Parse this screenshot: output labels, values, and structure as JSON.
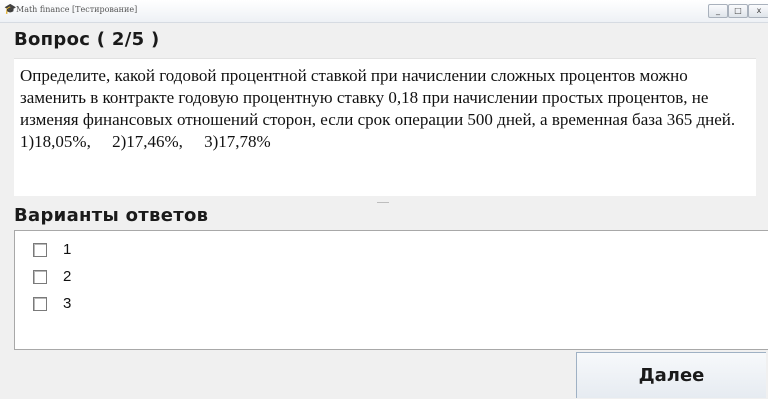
{
  "window": {
    "title": "Math finance [Тестирование]",
    "controls": {
      "minimize": "_",
      "maximize": "□",
      "close": "x"
    }
  },
  "question": {
    "header": "Вопрос ( 2/5 )",
    "text": "Определите, какой годовой процентной ставкой при начислении сложных процентов можно заменить в контракте годовую процентную ставку 0,18 при начислении простых процентов, не изменяя финансовых отношений сторон, если срок операции 500 дней, а временная база 365 дней.",
    "options_line": "1)18,05%,     2)17,46%,     3)17,78%"
  },
  "answers": {
    "header": "Варианты ответов",
    "items": [
      {
        "label": "1",
        "checked": false
      },
      {
        "label": "2",
        "checked": false
      },
      {
        "label": "3",
        "checked": false
      }
    ]
  },
  "buttons": {
    "next": "Далее"
  }
}
